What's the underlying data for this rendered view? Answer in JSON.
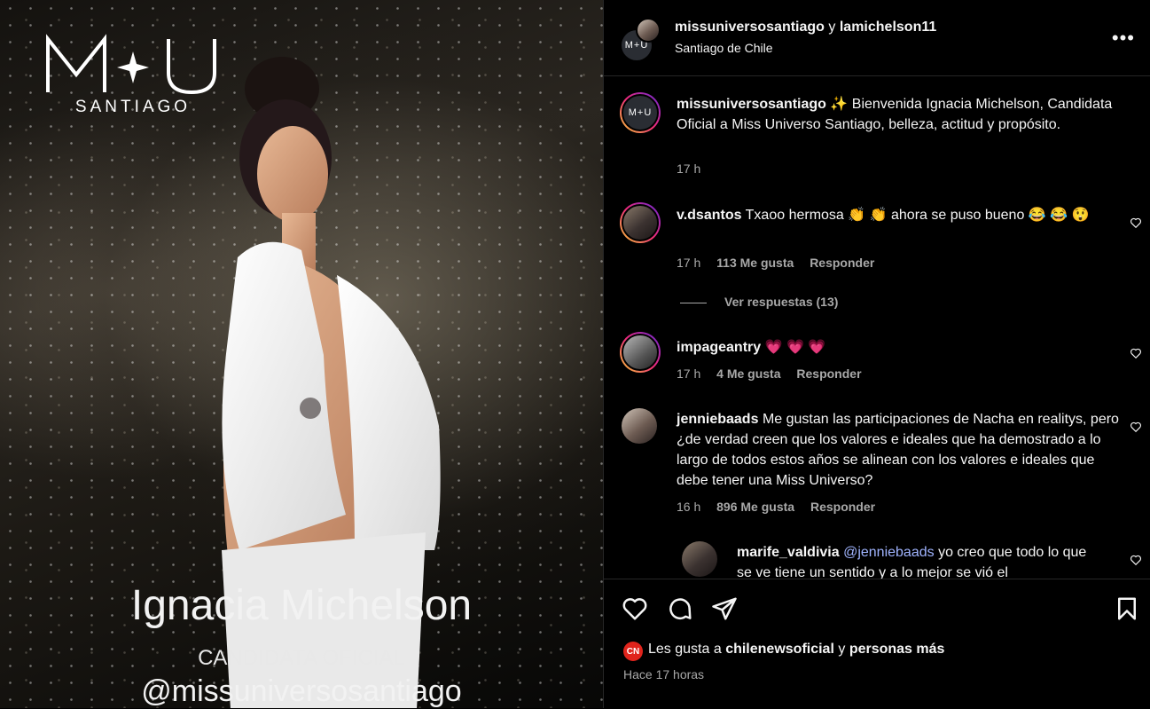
{
  "media": {
    "logo_letters": "M✦U",
    "logo_word": "SANTIAGO",
    "name": "Ignacia Michelson",
    "role": "CANDIDATA OFICIAL",
    "handle": "@missuniversosantiago"
  },
  "header": {
    "user1": "missuniversosantiago",
    "joiner": "y",
    "user2": "lamichelson11",
    "location": "Santiago de Chile",
    "more_label": "•••"
  },
  "caption": {
    "avatar_text": "M+U",
    "username": "missuniversosantiago",
    "text": "✨ Bienvenida Ignacia Michelson, Candidata Oficial a Miss Universo Santiago, belleza, actitud y propósito.",
    "time": "17 h"
  },
  "comments": [
    {
      "username": "v.dsantos",
      "text": "Txaoo hermosa 👏 👏 ahora se puso bueno 😂 😂 😲",
      "time": "17 h",
      "likes": "113 Me gusta",
      "reply": "Responder"
    },
    {
      "username": "impageantry",
      "text": "💗 💗 💗",
      "time": "17 h",
      "likes": "4 Me gusta",
      "reply": "Responder"
    },
    {
      "username": "jenniebaads",
      "text": "Me gustan las participaciones de Nacha en realitys, pero ¿de verdad creen que los valores e ideales que ha demostrado a lo largo de todos estos años se alinean con los valores e ideales que debe tener una Miss Universo?",
      "time": "16 h",
      "likes": "896 Me gusta",
      "reply": "Responder"
    }
  ],
  "view_replies": "Ver respuestas (13)",
  "reply": {
    "username": "marife_valdivia",
    "mention": "@jenniebaads",
    "text": "yo creo que todo lo que se ve tiene un sentido y a lo mejor se vió el"
  },
  "footer": {
    "liked_prefix": "Les gusta a",
    "liked_user": "chilenewsoficial",
    "liked_joiner": "y",
    "liked_rest": "personas más",
    "badge": "CN",
    "time_ago": "Hace 17 horas"
  },
  "colors": {
    "ring": "#ee2a7b",
    "mention": "#a0b4ff",
    "muted": "#a8a8a8"
  }
}
